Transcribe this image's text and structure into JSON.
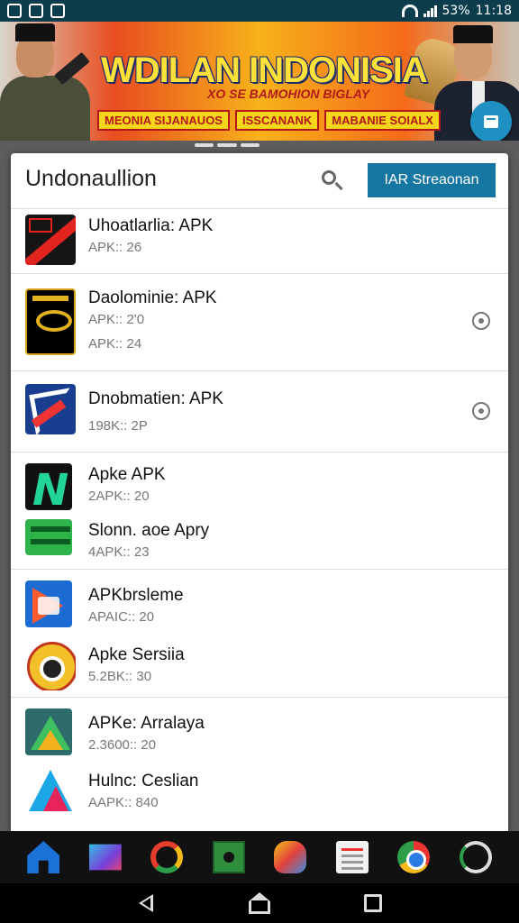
{
  "status_bar": {
    "battery": "53%",
    "time": "11:18"
  },
  "banner": {
    "title": "WDILAN INDONISIA",
    "subtitle": "XO SE BAMOHION BIGLAY",
    "ribbons": [
      "MEONIA SIJANAUOS",
      "ISSCANANK",
      "MABANIE SOIALX"
    ]
  },
  "header": {
    "title": "Undonaullion",
    "action_label": "IAR Streaonan"
  },
  "groups": [
    {
      "items": [
        {
          "name": "Uhoatlarlia: APK",
          "meta": "APK:: 26",
          "icon": "red-stripe-icon",
          "more": false
        }
      ]
    },
    {
      "items": [
        {
          "name": "Daolominie: APK",
          "meta": "APK:: 2'0",
          "meta2": "APK:: 24",
          "icon": "gold-emblem-icon",
          "more": true
        }
      ]
    },
    {
      "items": [
        {
          "name": "Dnobmatien: APK",
          "meta": "198K:: 2P",
          "icon": "blue-arrow-icon",
          "more": true
        }
      ]
    },
    {
      "items": [
        {
          "name": "Apke APK",
          "meta": "2APK:: 20",
          "icon": "green-n-icon",
          "more": false
        },
        {
          "name": "Slonn. aoe Apry",
          "meta": "4APK:: 23",
          "icon": "lime-bars-icon",
          "more": false
        }
      ]
    },
    {
      "items": [
        {
          "name": "APKbrsleme",
          "meta": "APAIC:: 20",
          "icon": "play-card-icon",
          "more": false
        },
        {
          "name": "Apke Sersiia",
          "meta": "5.2BK:: 30",
          "icon": "badge-icon",
          "more": false
        }
      ]
    },
    {
      "items": [
        {
          "name": "APKe: Arralaya",
          "meta": "2.3600:: 20",
          "icon": "triangle-drive-icon",
          "more": false
        },
        {
          "name": "Hulnc: Ceslian",
          "meta": "AAPK:: 840",
          "icon": "letter-a-icon",
          "more": false
        }
      ]
    }
  ],
  "dock": [
    "home-app-icon",
    "play-store-icon",
    "ring-app-icon",
    "puzzle-app-icon",
    "hand-app-icon",
    "docs-app-icon",
    "chrome-icon",
    "assistant-icon"
  ],
  "colors": {
    "status_bar": "#0b3d4c",
    "accent_button": "#1577a1",
    "fab": "#1e90c2"
  }
}
